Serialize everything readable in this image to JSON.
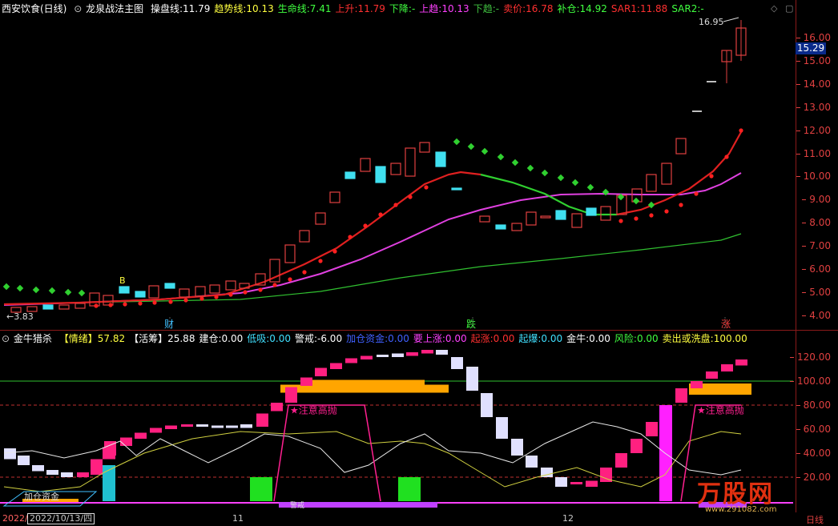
{
  "top": {
    "title": "西安饮食(日线)",
    "indicator_name": "龙泉战法主图",
    "values": [
      {
        "label": "操盘线",
        "value": "11.79",
        "color": "#ffffff"
      },
      {
        "label": "趋势线",
        "value": "10.13",
        "color": "#ffff40"
      },
      {
        "label": "生命线",
        "value": "7.41",
        "color": "#40ff40"
      },
      {
        "label": "上升",
        "value": "11.79",
        "color": "#ff3030"
      },
      {
        "label": "下降",
        "value": "-",
        "color": "#40ff40"
      },
      {
        "label": "上趋",
        "value": "10.13",
        "color": "#ff40ff"
      },
      {
        "label": "下趋",
        "value": "-",
        "color": "#40c040"
      },
      {
        "label": "卖价",
        "value": "16.78",
        "color": "#ff3030"
      },
      {
        "label": "补仓",
        "value": "14.92",
        "color": "#40ff40"
      },
      {
        "label": "SAR1",
        "value": "11.88",
        "color": "#ff3030"
      },
      {
        "label": "SAR2",
        "value": "-",
        "color": "#40ff40"
      }
    ],
    "ticks": [
      "16.00",
      "15.00",
      "14.00",
      "13.00",
      "12.00",
      "11.00",
      "10.00",
      "9.00",
      "8.00",
      "7.00",
      "6.00",
      "5.00",
      "4.00"
    ],
    "current_price": "15.29",
    "high_label": "16.95",
    "low_label": "3.83",
    "b_mark": "B",
    "markers": [
      "财",
      "跌",
      "涨"
    ],
    "icons": [
      "diamond-icon",
      "collapse-icon"
    ]
  },
  "bottom": {
    "title": "金牛猎杀",
    "values": [
      {
        "label": "【情绪】",
        "value": "57.82",
        "color": "#ffff40"
      },
      {
        "label": "【活筹】",
        "value": "25.88",
        "color": "#ffffff"
      },
      {
        "label": "建仓",
        "value": "0.00",
        "color": "#ffffff"
      },
      {
        "label": "低吸",
        "value": "0.00",
        "color": "#40e0ff"
      },
      {
        "label": "警戒",
        "value": "-6.00",
        "color": "#ffffff"
      },
      {
        "label": "加仓资金",
        "value": "0.00",
        "color": "#4060ff"
      },
      {
        "label": "要上涨",
        "value": "0.00",
        "color": "#ff40ff"
      },
      {
        "label": "起涨",
        "value": "0.00",
        "color": "#ff3030"
      },
      {
        "label": "起爆",
        "value": "0.00",
        "color": "#40e0ff"
      },
      {
        "label": "金牛",
        "value": "0.00",
        "color": "#ffffff"
      },
      {
        "label": "风险",
        "value": "0.00",
        "color": "#40ff40"
      },
      {
        "label": "卖出或洗盘",
        "value": "100.00",
        "color": "#ffff40"
      }
    ],
    "ticks": [
      "120.00",
      "100.00",
      "80.00",
      "60.00",
      "40.00",
      "20.00"
    ],
    "annotations": [
      "★注意高抛",
      "★注意高抛"
    ],
    "bottom_text": "加仓资金",
    "bottom_text2": "警戒"
  },
  "dates": {
    "d1": "2022/",
    "d2": "2022/10/13/四",
    "d3": "11",
    "d4": "12",
    "period": "日线"
  },
  "watermark": {
    "brand": "万股网",
    "url": "www.291082.com"
  }
}
